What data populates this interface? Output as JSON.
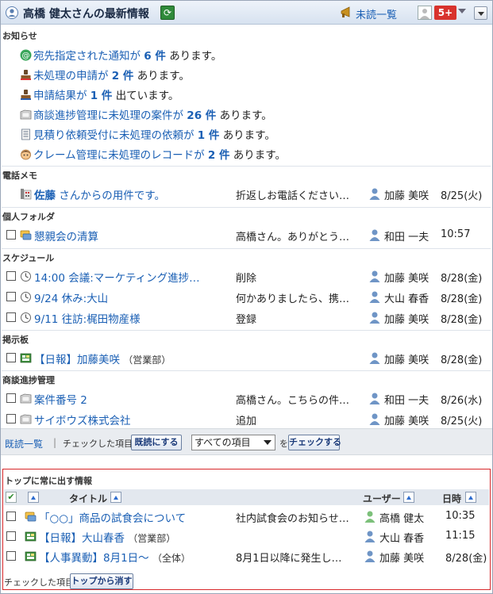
{
  "header": {
    "title": "高橋 健太さんの最新情報",
    "unread_label": "未読一覧",
    "badge": "5+"
  },
  "sections": {
    "notice": "お知らせ",
    "memo": "電話メモ",
    "folder": "個人フォルダ",
    "schedule": "スケジュール",
    "board": "掲示板",
    "deals": "商談進捗管理"
  },
  "notices": [
    {
      "link": "宛先指定された通知が",
      "count": "6 件",
      "suffix": "あります。"
    },
    {
      "link": "未処理の申請が",
      "count": "2 件",
      "suffix": "あります。"
    },
    {
      "link": "申請結果が",
      "count": "1 件",
      "suffix": "出ています。"
    },
    {
      "link": "商談進捗管理に未処理の案件が",
      "count": "26 件",
      "suffix": "あります。"
    },
    {
      "link": "見積り依頼受付に未処理の依頼が",
      "count": "1 件",
      "suffix": "あります。"
    },
    {
      "link": "クレーム管理に未処理のレコードが",
      "count": "2 件",
      "suffix": "あります。"
    }
  ],
  "memo": {
    "name": "佐藤",
    "title": "さんからの用件です。",
    "preview": "折返しお電話ください…",
    "user": "加藤 美咲",
    "date": "8/25(火)"
  },
  "folder": {
    "title": "懇親会の清算",
    "preview": "高橋さん。ありがとう…",
    "user": "和田 一夫",
    "date": "10:57"
  },
  "schedule": [
    {
      "title": "14:00 会議:マーケティング進捗…",
      "preview": "削除",
      "user": "加藤 美咲",
      "date": "8/28(金)"
    },
    {
      "title": "9/24 休み:大山",
      "preview": "何かありましたら、携…",
      "user": "大山 春香",
      "date": "8/28(金)"
    },
    {
      "title": "9/11 往訪:梶田物産様",
      "preview": "登録",
      "user": "加藤 美咲",
      "date": "8/28(金)"
    }
  ],
  "board": {
    "title": "【日報】加藤美咲",
    "extra": "（営業部）",
    "user": "加藤 美咲",
    "date": "8/28(金)"
  },
  "deals": [
    {
      "title": "案件番号 2",
      "preview": "高橋さん。こちらの件…",
      "user": "和田 一夫",
      "date": "8/26(水)"
    },
    {
      "title": "サイボウズ株式会社",
      "preview": "追加",
      "user": "加藤 美咲",
      "date": "8/25(火)"
    }
  ],
  "toolbar": {
    "read_list": "既読一覧",
    "bar": "|",
    "checked_label": "チェックした項目を",
    "mark_read": "既読にする",
    "select_value": "すべての項目",
    "wo": "を",
    "check": "チェックする"
  },
  "pinned": {
    "title": "トップに常に出す情報",
    "col_title": "タイトル",
    "col_user": "ユーザー",
    "col_date": "日時",
    "rows": [
      {
        "title": "「○○」商品の試食会について",
        "extra": "",
        "preview": "社内試食会のお知らせ…",
        "user": "高橋 健太",
        "date": "10:35"
      },
      {
        "title": "【日報】大山春香",
        "extra": "（営業部）",
        "preview": "",
        "user": "大山 春香",
        "date": "11:15"
      },
      {
        "title": "【人事異動】8月1日～",
        "extra": "（全体）",
        "preview": "8月1日以降に発生し…",
        "user": "加藤 美咲",
        "date": "8/28(金)"
      }
    ],
    "footer_label": "チェックした項目を",
    "remove_button": "トップから消す"
  },
  "colors": {
    "accent": "#1a5fb4",
    "badge": "#d8332d",
    "pin_border": "#d8282a"
  }
}
